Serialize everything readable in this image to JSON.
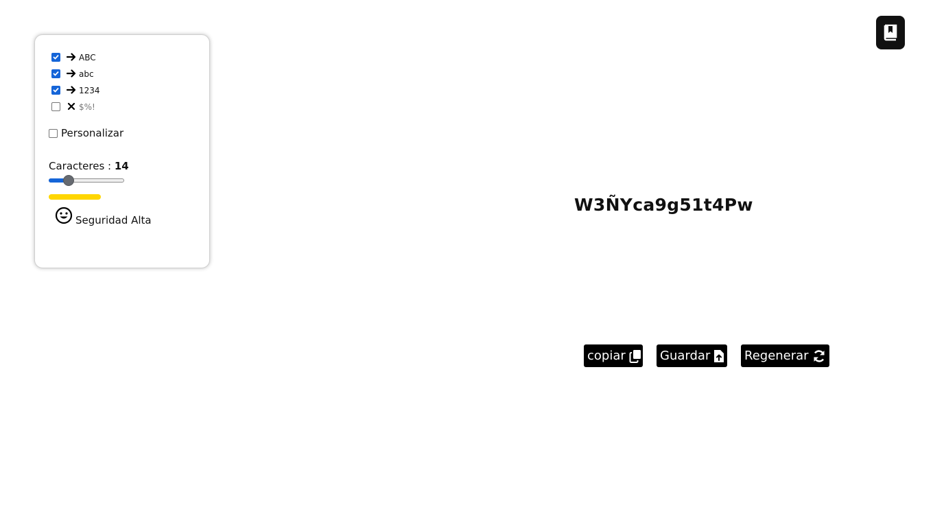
{
  "options": [
    {
      "label": "ABC",
      "checked": true,
      "glyph": "arrow-right-icon"
    },
    {
      "label": "abc",
      "checked": true,
      "glyph": "arrow-right-icon"
    },
    {
      "label": "1234",
      "checked": true,
      "glyph": "arrow-right-icon"
    },
    {
      "label": "$%!",
      "checked": false,
      "glyph": "x-mark-icon"
    }
  ],
  "custom": {
    "label": "Personalizar",
    "checked": false
  },
  "length": {
    "label": "Caracteres : ",
    "value": "14",
    "fraction": 0.23
  },
  "strength": {
    "color": "#FFD600",
    "icon": "smile-icon",
    "label": "Seguridad Alta"
  },
  "password": "W3ÑYca9g51t4Pw",
  "buttons": {
    "copy": {
      "label": "copiar",
      "icon": "copy-icon"
    },
    "save": {
      "label": "Guardar",
      "icon": "file-upload-icon"
    },
    "regenerate": {
      "label": "Regenerar",
      "icon": "refresh-icon"
    }
  },
  "top_icon": "bookmark-book-icon",
  "colors": {
    "accent": "#1565d8",
    "button_bg": "#000000",
    "strength": "#FFD600"
  }
}
